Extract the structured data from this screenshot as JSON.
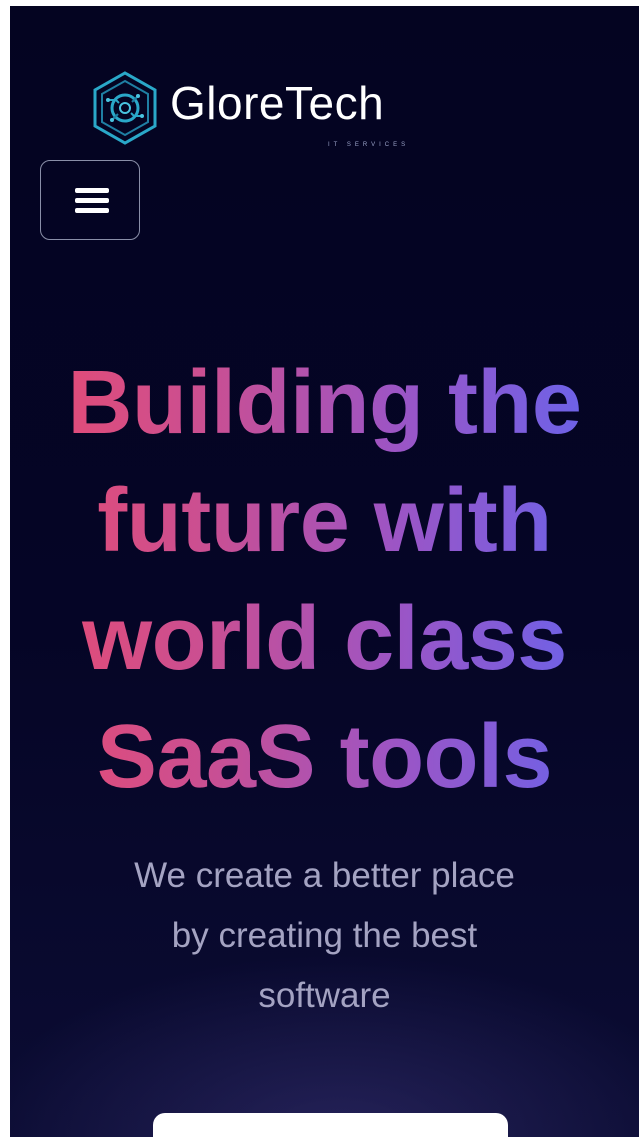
{
  "header": {
    "brand_name": "GloreTech",
    "brand_tagline": "IT SERVICES",
    "logo_icon": "hexagon-circuit-logo",
    "menu_icon": "hamburger-menu-icon"
  },
  "hero": {
    "headline_lines": [
      "Building the",
      "future with",
      "world class",
      "SaaS tools"
    ],
    "subtitle_lines": [
      "We create a better place",
      "by creating the best",
      "software"
    ]
  },
  "cta": {
    "label": ""
  },
  "colors": {
    "background": "#050526",
    "gradient_start": "#e94b70",
    "gradient_mid": "#9b55c6",
    "gradient_end": "#5f66f2",
    "subtitle": "#a4a3c2",
    "logo_accent": "#2aa8c9"
  }
}
